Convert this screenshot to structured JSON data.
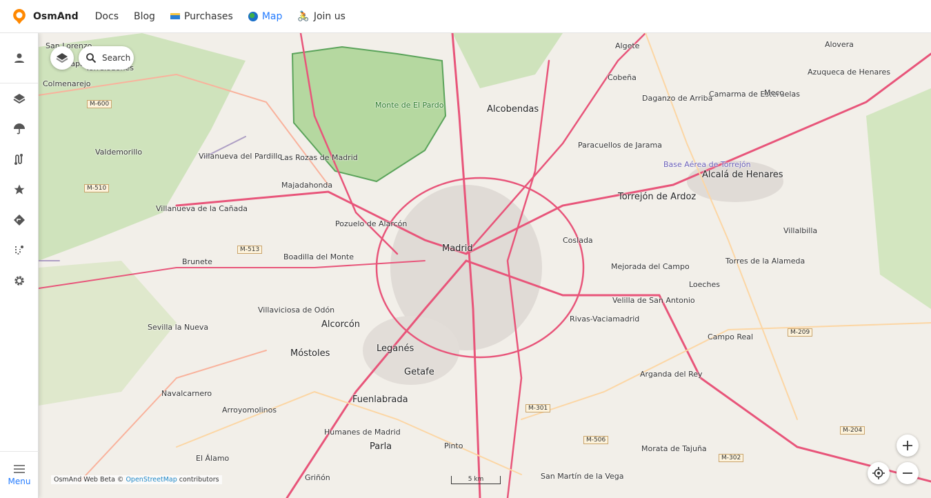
{
  "header": {
    "brand": "OsmAnd",
    "nav": [
      {
        "label": "Docs"
      },
      {
        "label": "Blog"
      },
      {
        "label": "Purchases",
        "icon": "credit-card-icon"
      },
      {
        "label": "Map",
        "icon": "globe-icon",
        "active": true
      },
      {
        "label": "Join us",
        "icon": "cyclist-icon"
      }
    ]
  },
  "sidebar": {
    "items": [
      {
        "icon": "account-icon"
      },
      {
        "icon": "layers-icon"
      },
      {
        "icon": "weather-umbrella-icon"
      },
      {
        "icon": "tracks-icon"
      },
      {
        "icon": "favorites-star-icon"
      },
      {
        "icon": "navigation-icon"
      },
      {
        "icon": "plan-route-icon"
      },
      {
        "icon": "settings-gear-icon"
      }
    ],
    "menu_label": "Menu"
  },
  "map": {
    "search_label": "Search",
    "attribution_prefix": "OsmAnd Web Beta ©",
    "attribution_link": "OpenStreetMap",
    "attribution_suffix": "contributors",
    "scale": "5 km",
    "colors": {
      "background": "#f2efe9",
      "forest": "#add19e",
      "park": "#c8facc",
      "urban": "#d9d0c9",
      "motorway": "#e8557a",
      "trunk": "#f9b29c",
      "primary": "#fcd6a4",
      "accent": "#237bff"
    },
    "places": [
      {
        "name": "Madrid",
        "big": true
      },
      {
        "name": "Alcobendas",
        "big": true
      },
      {
        "name": "Alcorcón",
        "big": true
      },
      {
        "name": "Móstoles",
        "big": true
      },
      {
        "name": "Leganés",
        "big": true
      },
      {
        "name": "Getafe",
        "big": true
      },
      {
        "name": "Fuenlabrada",
        "big": true
      },
      {
        "name": "Parla",
        "big": true
      },
      {
        "name": "Alcalá de Henares",
        "big": true
      },
      {
        "name": "Torrejón de Ardoz",
        "big": true
      },
      {
        "name": "Galapagar"
      },
      {
        "name": "Torrelodones"
      },
      {
        "name": "Colmenarejo"
      },
      {
        "name": "Valdemorillo"
      },
      {
        "name": "Villanueva del Pardillo"
      },
      {
        "name": "Las Rozas de Madrid"
      },
      {
        "name": "Majadahonda"
      },
      {
        "name": "Villanueva de la Cañada"
      },
      {
        "name": "Pozuelo de Alarcón"
      },
      {
        "name": "Boadilla del Monte"
      },
      {
        "name": "Brunete"
      },
      {
        "name": "Villaviciosa de Odón"
      },
      {
        "name": "Sevilla la Nueva"
      },
      {
        "name": "Navalcarnero"
      },
      {
        "name": "Arroyomolinos"
      },
      {
        "name": "Humanes de Madrid"
      },
      {
        "name": "El Álamo"
      },
      {
        "name": "Griñón"
      },
      {
        "name": "Pinto"
      },
      {
        "name": "San Martín de la Vega"
      },
      {
        "name": "Monte de El Pardo"
      },
      {
        "name": "Algete"
      },
      {
        "name": "Cobeña"
      },
      {
        "name": "Daganzo de Arriba"
      },
      {
        "name": "Paracuellos de Jarama"
      },
      {
        "name": "Camarma de Esteruelas"
      },
      {
        "name": "Meco"
      },
      {
        "name": "Azuqueca de Henares"
      },
      {
        "name": "Alovera"
      },
      {
        "name": "Coslada"
      },
      {
        "name": "Mejorada del Campo"
      },
      {
        "name": "Velilla de San Antonio"
      },
      {
        "name": "Rivas-Vaciamadrid"
      },
      {
        "name": "Loeches"
      },
      {
        "name": "Torres de la Alameda"
      },
      {
        "name": "Villalbilla"
      },
      {
        "name": "Campo Real"
      },
      {
        "name": "Arganda del Rey"
      },
      {
        "name": "Morata de Tajuña"
      },
      {
        "name": "Base Aérea de Torrejón"
      },
      {
        "name": "San Lorenzo"
      }
    ],
    "roads": [
      "M-600",
      "M-510",
      "M-513",
      "M-301",
      "M-506",
      "M-302",
      "M-209",
      "M-204"
    ]
  }
}
